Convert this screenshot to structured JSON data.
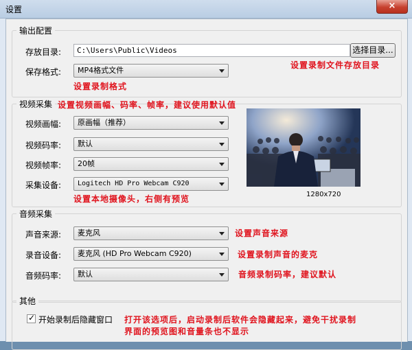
{
  "window": {
    "title": "设置",
    "close_glyph": "×"
  },
  "output": {
    "legend": "输出配置",
    "dir_label": "存放目录:",
    "dir_value": "C:\\Users\\Public\\Videos",
    "browse_button": "选择目录...",
    "dir_note": "设置录制文件存放目录",
    "format_label": "保存格式:",
    "format_value": "MP4格式文件",
    "format_note": "设置录制格式"
  },
  "video": {
    "legend": "视频采集",
    "legend_note": "设置视频画幅、码率、帧率，建议使用默认值",
    "size_label": "视频画幅:",
    "size_value": "原画幅（推荐）",
    "bitrate_label": "视频码率:",
    "bitrate_value": "默认",
    "fps_label": "视频帧率:",
    "fps_value": "20帧",
    "device_label": "采集设备:",
    "device_value": "Logitech HD Pro Webcam C920",
    "device_note": "设置本地摄像头，右侧有预览",
    "preview_resolution": "1280x720"
  },
  "audio": {
    "legend": "音频采集",
    "source_label": "声音来源:",
    "source_value": "麦克风",
    "source_note": "设置声音来源",
    "device_label": "录音设备:",
    "device_value": "麦克风 (HD Pro Webcam C920)",
    "device_note": "设置录制声音的麦克",
    "bitrate_label": "音频码率:",
    "bitrate_value": "默认",
    "bitrate_note": "音频录制码率，建议默认"
  },
  "other": {
    "legend": "其他",
    "hide_checkbox_label": "开始录制后隐藏窗口",
    "hide_checked": true,
    "hide_note": "打开该选项后，启动录制后软件会隐藏起来，避免干扰录制",
    "hide_note_cont": "界面的预览图和音量条也不显示"
  },
  "colors": {
    "note_red": "#e0141e",
    "titlebar": "#c4d5e8",
    "dialog_bg": "#f0f0f0"
  },
  "icons": {
    "checkbox": "check-mark-icon",
    "combo_arrow": "chevron-down-icon",
    "close": "close-icon"
  }
}
